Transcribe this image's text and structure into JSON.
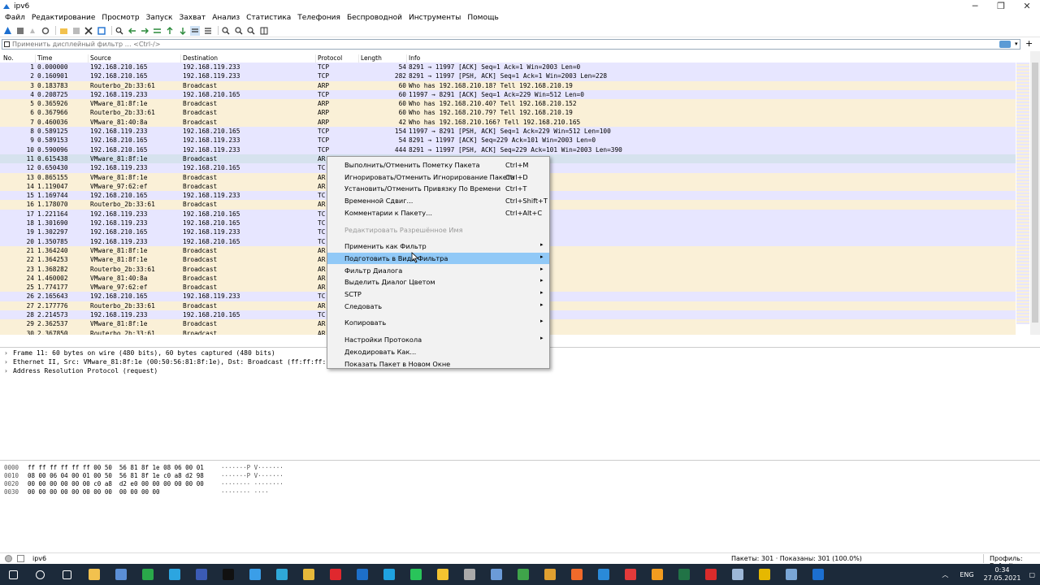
{
  "window": {
    "title": "ipv6",
    "controls": [
      "─",
      "❐",
      "✕"
    ]
  },
  "menu": [
    "Файл",
    "Редактирование",
    "Просмотр",
    "Запуск",
    "Захват",
    "Анализ",
    "Статистика",
    "Телефония",
    "Беспроводной",
    "Инструменты",
    "Помощь"
  ],
  "filter": {
    "placeholder": "Применить дисплейный фильтр … <Ctrl-/>"
  },
  "packet_list": {
    "columns": [
      "No.",
      "Time",
      "Source",
      "Destination",
      "Protocol",
      "Length",
      "Info"
    ],
    "rows": [
      {
        "no": "1",
        "time": "0.000000",
        "src": "192.168.210.165",
        "dst": "192.168.119.233",
        "proto": "TCP",
        "len": "54",
        "info": "8291 → 11997 [ACK] Seq=1 Ack=1 Win=2003 Len=0",
        "kind": "tcp"
      },
      {
        "no": "2",
        "time": "0.160901",
        "src": "192.168.210.165",
        "dst": "192.168.119.233",
        "proto": "TCP",
        "len": "282",
        "info": "8291 → 11997 [PSH, ACK] Seq=1 Ack=1 Win=2003 Len=228",
        "kind": "tcp"
      },
      {
        "no": "3",
        "time": "0.183783",
        "src": "Routerbo_2b:33:61",
        "dst": "Broadcast",
        "proto": "ARP",
        "len": "60",
        "info": "Who has 192.168.210.18? Tell 192.168.210.19",
        "kind": "arp"
      },
      {
        "no": "4",
        "time": "0.208725",
        "src": "192.168.119.233",
        "dst": "192.168.210.165",
        "proto": "TCP",
        "len": "60",
        "info": "11997 → 8291 [ACK] Seq=1 Ack=229 Win=512 Len=0",
        "kind": "tcp"
      },
      {
        "no": "5",
        "time": "0.365926",
        "src": "VMware_81:8f:1e",
        "dst": "Broadcast",
        "proto": "ARP",
        "len": "60",
        "info": "Who has 192.168.210.40? Tell 192.168.210.152",
        "kind": "arp"
      },
      {
        "no": "6",
        "time": "0.367966",
        "src": "Routerbo_2b:33:61",
        "dst": "Broadcast",
        "proto": "ARP",
        "len": "60",
        "info": "Who has 192.168.210.79? Tell 192.168.210.19",
        "kind": "arp"
      },
      {
        "no": "7",
        "time": "0.460036",
        "src": "VMware_81:40:8a",
        "dst": "Broadcast",
        "proto": "ARP",
        "len": "42",
        "info": "Who has 192.168.210.166? Tell 192.168.210.165",
        "kind": "arp"
      },
      {
        "no": "8",
        "time": "0.589125",
        "src": "192.168.119.233",
        "dst": "192.168.210.165",
        "proto": "TCP",
        "len": "154",
        "info": "11997 → 8291 [PSH, ACK] Seq=1 Ack=229 Win=512 Len=100",
        "kind": "tcp"
      },
      {
        "no": "9",
        "time": "0.589153",
        "src": "192.168.210.165",
        "dst": "192.168.119.233",
        "proto": "TCP",
        "len": "54",
        "info": "8291 → 11997 [ACK] Seq=229 Ack=101 Win=2003 Len=0",
        "kind": "tcp"
      },
      {
        "no": "10",
        "time": "0.590096",
        "src": "192.168.210.165",
        "dst": "192.168.119.233",
        "proto": "TCP",
        "len": "444",
        "info": "8291 → 11997 [PSH, ACK] Seq=229 Ack=101 Win=2003 Len=390",
        "kind": "tcp"
      },
      {
        "no": "11",
        "time": "0.615438",
        "src": "VMware_81:8f:1e",
        "dst": "Broadcast",
        "proto": "AR",
        "len": "",
        "info": "210.152",
        "kind": "sel"
      },
      {
        "no": "12",
        "time": "0.650430",
        "src": "192.168.119.233",
        "dst": "192.168.210.165",
        "proto": "TC",
        "len": "",
        "info": "=510 Len=0",
        "kind": "tcp"
      },
      {
        "no": "13",
        "time": "0.865155",
        "src": "VMware_81:8f:1e",
        "dst": "Broadcast",
        "proto": "AR",
        "len": "",
        "info": "210.152",
        "kind": "arp"
      },
      {
        "no": "14",
        "time": "1.119047",
        "src": "VMware_97:62:ef",
        "dst": "Broadcast",
        "proto": "AR",
        "len": "",
        "info": "210.47",
        "kind": "arp"
      },
      {
        "no": "15",
        "time": "1.169744",
        "src": "192.168.210.165",
        "dst": "192.168.119.233",
        "proto": "TC",
        "len": "",
        "info": "01 Win=2003 Len=180",
        "kind": "tcp"
      },
      {
        "no": "16",
        "time": "1.178070",
        "src": "Routerbo_2b:33:61",
        "dst": "Broadcast",
        "proto": "AR",
        "len": "",
        "info": "210.19",
        "kind": "arp"
      },
      {
        "no": "17",
        "time": "1.221164",
        "src": "192.168.119.233",
        "dst": "192.168.210.165",
        "proto": "TC",
        "len": "",
        "info": "=510 Len=0",
        "kind": "tcp"
      },
      {
        "no": "18",
        "time": "1.301690",
        "src": "192.168.119.233",
        "dst": "192.168.210.165",
        "proto": "TC",
        "len": "",
        "info": "99 Win=510 Len=100",
        "kind": "tcp"
      },
      {
        "no": "19",
        "time": "1.302297",
        "src": "192.168.210.165",
        "dst": "192.168.119.233",
        "proto": "TC",
        "len": "",
        "info": "01 Win=2003 Len=390",
        "kind": "tcp"
      },
      {
        "no": "20",
        "time": "1.350785",
        "src": "192.168.119.233",
        "dst": "192.168.210.165",
        "proto": "TC",
        "len": "",
        "info": "in=508 Len=0",
        "kind": "tcp"
      },
      {
        "no": "21",
        "time": "1.364240",
        "src": "VMware_81:8f:1e",
        "dst": "Broadcast",
        "proto": "AR",
        "len": "",
        "info": "210.152",
        "kind": "arp"
      },
      {
        "no": "22",
        "time": "1.364253",
        "src": "VMware_81:8f:1e",
        "dst": "Broadcast",
        "proto": "AR",
        "len": "",
        "info": ".210.152",
        "kind": "arp"
      },
      {
        "no": "23",
        "time": "1.368282",
        "src": "Routerbo_2b:33:61",
        "dst": "Broadcast",
        "proto": "AR",
        "len": "",
        "info": "210.19",
        "kind": "arp"
      },
      {
        "no": "24",
        "time": "1.460002",
        "src": "VMware_81:40:8a",
        "dst": "Broadcast",
        "proto": "AR",
        "len": "",
        "info": "210.165",
        "kind": "arp"
      },
      {
        "no": "25",
        "time": "1.774177",
        "src": "VMware_97:62:ef",
        "dst": "Broadcast",
        "proto": "AR",
        "len": "",
        "info": "210.47",
        "kind": "arp"
      },
      {
        "no": "26",
        "time": "2.165643",
        "src": "192.168.210.165",
        "dst": "192.168.119.233",
        "proto": "TC",
        "len": "",
        "info": "201 Win=2003 Len=180",
        "kind": "tcp"
      },
      {
        "no": "27",
        "time": "2.177776",
        "src": "Routerbo_2b:33:61",
        "dst": "Broadcast",
        "proto": "AR",
        "len": "",
        "info": "210.19",
        "kind": "arp"
      },
      {
        "no": "28",
        "time": "2.214573",
        "src": "192.168.119.233",
        "dst": "192.168.210.165",
        "proto": "TC",
        "len": "",
        "info": "in=507 Len=0",
        "kind": "tcp"
      },
      {
        "no": "29",
        "time": "2.362537",
        "src": "VMware_81:8f:1e",
        "dst": "Broadcast",
        "proto": "AR",
        "len": "",
        "info": "210.152",
        "kind": "arp"
      },
      {
        "no": "30",
        "time": "2.367850",
        "src": "Routerbo_2b:33:61",
        "dst": "Broadcast",
        "proto": "AR",
        "len": "",
        "info": "210.19",
        "kind": "arp"
      }
    ]
  },
  "details": [
    "Frame 11: 60 bytes on wire (480 bits), 60 bytes captured (480 bits)",
    "Ethernet II, Src: VMware_81:8f:1e (00:50:56:81:8f:1e), Dst: Broadcast (ff:ff:ff:ff",
    "Address Resolution Protocol (request)"
  ],
  "hex": [
    {
      "off": "0000",
      "bytes": "ff ff ff ff ff ff 00 50  56 81 8f 1e 08 06 00 01",
      "ascii": "·······P V·······"
    },
    {
      "off": "0010",
      "bytes": "08 00 06 04 00 01 00 50  56 81 8f 1e c0 a8 d2 98",
      "ascii": "·······P V·······"
    },
    {
      "off": "0020",
      "bytes": "00 00 00 00 00 00 c0 a8  d2 e0 00 00 00 00 00 00",
      "ascii": "········ ········"
    },
    {
      "off": "0030",
      "bytes": "00 00 00 00 00 00 00 00  00 00 00 00",
      "ascii": "········ ····"
    }
  ],
  "context_menu": [
    {
      "label": "Выполнить/Отменить Пометку Пакета",
      "shortcut": "Ctrl+M",
      "submenu": false,
      "disabled": false
    },
    {
      "label": "Игнорировать/Отменить Игнорирование Пакета",
      "shortcut": "Ctrl+D",
      "submenu": false,
      "disabled": false
    },
    {
      "label": "Установить/Отменить Привязку По Времени",
      "shortcut": "Ctrl+T",
      "submenu": false,
      "disabled": false
    },
    {
      "label": "Временной Сдвиг...",
      "shortcut": "Ctrl+Shift+T",
      "submenu": false,
      "disabled": false
    },
    {
      "label": "Комментарии к Пакету...",
      "shortcut": "Ctrl+Alt+C",
      "submenu": false,
      "disabled": false
    },
    {
      "separator": true
    },
    {
      "label": "Редактировать Разрешённое Имя",
      "shortcut": "",
      "submenu": false,
      "disabled": true
    },
    {
      "separator": true
    },
    {
      "label": "Применить как Фильтр",
      "shortcut": "",
      "submenu": true,
      "disabled": false
    },
    {
      "label": "Подготовить в Виде Фильтра",
      "shortcut": "",
      "submenu": true,
      "disabled": false,
      "highlighted": true
    },
    {
      "label": "Фильтр Диалога",
      "shortcut": "",
      "submenu": true,
      "disabled": false
    },
    {
      "label": "Выделить Диалог Цветом",
      "shortcut": "",
      "submenu": true,
      "disabled": false
    },
    {
      "label": "SCTP",
      "shortcut": "",
      "submenu": true,
      "disabled": false
    },
    {
      "label": "Следовать",
      "shortcut": "",
      "submenu": true,
      "disabled": false
    },
    {
      "separator": true
    },
    {
      "label": "Копировать",
      "shortcut": "",
      "submenu": true,
      "disabled": false
    },
    {
      "separator": true
    },
    {
      "label": "Настройки Протокола",
      "shortcut": "",
      "submenu": true,
      "disabled": false
    },
    {
      "label": "Декодировать Как...",
      "shortcut": "",
      "submenu": false,
      "disabled": false
    },
    {
      "label": "Показать Пакет в Новом Окне",
      "shortcut": "",
      "submenu": false,
      "disabled": false
    }
  ],
  "status": {
    "file": "ipv6",
    "packets": "Пакеты: 301 · Показаны: 301 (100.0%)",
    "profile": "Профиль: Default"
  },
  "taskbar": {
    "apps": [
      {
        "name": "start-icon",
        "color": "#ffffff"
      },
      {
        "name": "search-icon",
        "color": "#ffffff"
      },
      {
        "name": "task-view-icon",
        "color": "#ffffff"
      },
      {
        "name": "explorer-icon",
        "color": "#f2c14e"
      },
      {
        "name": "app-icon",
        "color": "#5b8fd6"
      },
      {
        "name": "app-icon",
        "color": "#2aa84a"
      },
      {
        "name": "telegram-icon",
        "color": "#2ca5e0"
      },
      {
        "name": "app-icon",
        "color": "#3b5bb5"
      },
      {
        "name": "terminal-icon",
        "color": "#111111"
      },
      {
        "name": "vscode-icon",
        "color": "#3a9ee8"
      },
      {
        "name": "edge-icon",
        "color": "#2fa8d8"
      },
      {
        "name": "chrome-icon",
        "color": "#e8b93a"
      },
      {
        "name": "opera-icon",
        "color": "#e0282e"
      },
      {
        "name": "outlook-icon",
        "color": "#1d6fc9"
      },
      {
        "name": "skype-icon",
        "color": "#1fa2e0"
      },
      {
        "name": "whatsapp-icon",
        "color": "#29c45a"
      },
      {
        "name": "notes-icon",
        "color": "#f4c430"
      },
      {
        "name": "app-icon",
        "color": "#aaaaaa"
      },
      {
        "name": "app-icon",
        "color": "#6b9bd8"
      },
      {
        "name": "app-icon",
        "color": "#3fa44a"
      },
      {
        "name": "app-icon",
        "color": "#e0a030"
      },
      {
        "name": "firefox-icon",
        "color": "#f06a2a"
      },
      {
        "name": "ie-icon",
        "color": "#2a8ad8"
      },
      {
        "name": "vivaldi-icon",
        "color": "#e33a3a"
      },
      {
        "name": "app-icon",
        "color": "#f29c1f"
      },
      {
        "name": "excel-icon",
        "color": "#217346"
      },
      {
        "name": "acrobat-icon",
        "color": "#d92b2b"
      },
      {
        "name": "app-icon",
        "color": "#9db8d8"
      },
      {
        "name": "lock-icon",
        "color": "#e6b800"
      },
      {
        "name": "app-icon",
        "color": "#7aa6d6"
      },
      {
        "name": "wireshark-icon",
        "color": "#1c6fd0"
      }
    ],
    "lang": "ENG",
    "time": "0:34",
    "date": "27.05.2021"
  }
}
